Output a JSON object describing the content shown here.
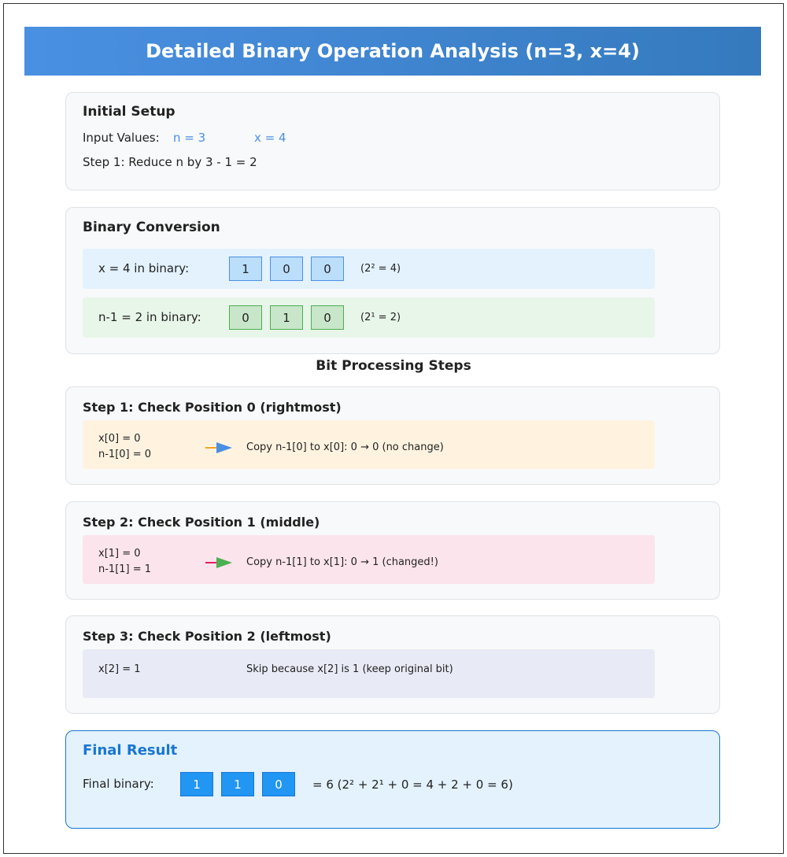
{
  "header": {
    "title": "Detailed Binary Operation Analysis (n=3, x=4)"
  },
  "setup": {
    "title": "Initial Setup",
    "input_label": "Input Values:",
    "n_value": "n = 3",
    "x_value": "x = 4",
    "step_text": "Step 1: Reduce n by  3  - 1 = 2"
  },
  "conversion": {
    "title": "Binary Conversion",
    "x_row": {
      "label": "x = 4 in binary:",
      "bits": [
        "1",
        "0",
        "0"
      ],
      "note": "(2² = 4)"
    },
    "n_row": {
      "label": "n-1 = 2 in binary:",
      "bits": [
        "0",
        "1",
        "0"
      ],
      "note": "(2¹ = 2)"
    }
  },
  "processing_title": "Bit Processing Steps",
  "steps": [
    {
      "title": "Step 1: Check Position 0 (rightmost)",
      "line1": "x[0] = 0",
      "line2": "n-1[0] = 0",
      "action": "Copy n-1[0] to x[0]: 0 → 0 (no change)",
      "bg_color": "#fff3e0",
      "arrow_color": "#f5a623",
      "arrowhead_color": "#4a90e2"
    },
    {
      "title": "Step 2: Check Position 1 (middle)",
      "line1": "x[1] = 0",
      "line2": "n-1[1] = 1",
      "action": "Copy n-1[1] to x[1]: 0 → 1 (changed!)",
      "bg_color": "#fce4ec",
      "arrow_color": "#e91e63",
      "arrowhead_color": "#4caf50"
    },
    {
      "title": "Step 3: Check Position 2 (leftmost)",
      "line1": "x[2] = 1",
      "action": "Skip because x[2] is 1 (keep original bit)",
      "bg_color": "#e8eaf6"
    }
  ],
  "final": {
    "title": "Final Result",
    "label": "Final binary:",
    "bits": [
      "1",
      "1",
      "0"
    ],
    "equation": "= 6 (2² + 2¹ + 0 = 4 + 2 + 0 = 6)",
    "bg_color": "#e3f2fd",
    "border_color": "#1976d2",
    "title_color": "#1976d2"
  }
}
